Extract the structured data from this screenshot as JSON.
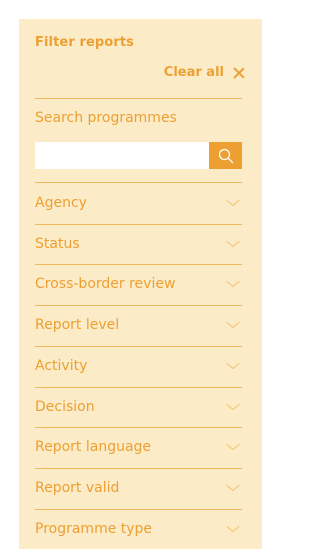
{
  "panel": {
    "title": "Filter reports",
    "clear_all_label": "Clear all",
    "search_label": "Search programmes",
    "search_value": "",
    "search_placeholder": ""
  },
  "filters": [
    {
      "label": "Agency",
      "icon": "chevron-down-icon"
    },
    {
      "label": "Status",
      "icon": "chevron-down-icon"
    },
    {
      "label": "Cross-border review",
      "icon": "chevron-down-icon"
    },
    {
      "label": "Report level",
      "icon": "chevron-down-icon"
    },
    {
      "label": "Activity",
      "icon": "chevron-down-icon"
    },
    {
      "label": "Decision",
      "icon": "chevron-down-icon"
    },
    {
      "label": "Report language",
      "icon": "chevron-down-icon"
    },
    {
      "label": "Report valid",
      "icon": "chevron-down-icon"
    },
    {
      "label": "Programme type",
      "icon": "chevron-down-icon"
    }
  ],
  "colors": {
    "panel_background": "#fbecc7",
    "accent": "#ee9f32",
    "divider": "#f0b85a",
    "chevron": "#f5c980"
  }
}
